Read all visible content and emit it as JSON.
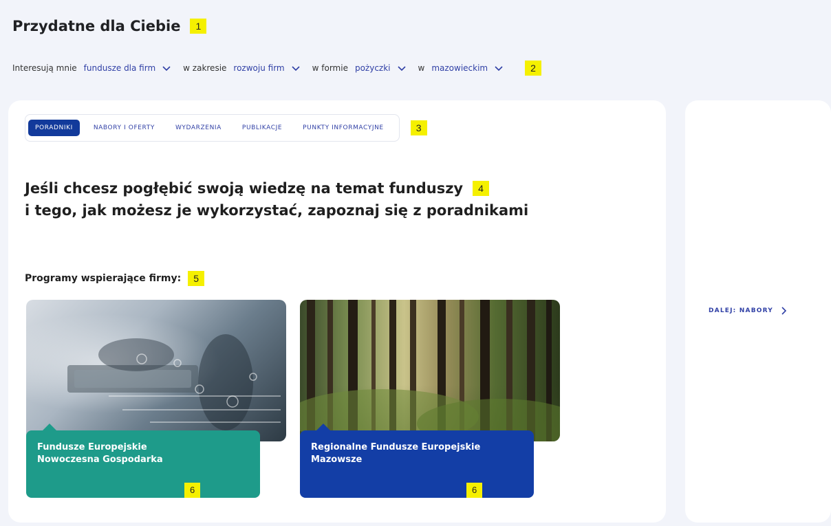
{
  "header": {
    "title": "Przydatne dla Ciebie",
    "marker": "1"
  },
  "filters": {
    "prefix": "Interesują mnie",
    "in_scope": "w zakresie",
    "in_form": "w formie",
    "in_region": "w",
    "funds": "fundusze dla firm",
    "scope": "rozwoju firm",
    "form": "pożyczki",
    "region": "mazowieckim",
    "marker": "2"
  },
  "tabs": {
    "items": [
      "PORADNIKI",
      "NABORY I OFERTY",
      "WYDARZENIA",
      "PUBLIKACJE",
      "PUNKTY INFORMACYJNE"
    ],
    "active": "PORADNIKI",
    "marker": "3"
  },
  "lead": {
    "line1": "Jeśli chcesz pogłębić swoją wiedzę na temat funduszy",
    "line2": "i tego, jak możesz je wykorzystać, zapoznaj się z poradnikami",
    "marker": "4"
  },
  "programs": {
    "label": "Programy wspierające firmy:",
    "marker": "5",
    "cards": [
      {
        "title_line1": "Fundusze Europejskie",
        "title_line2": "Nowoczesna Gospodarka",
        "marker": "6"
      },
      {
        "title_line1": "Regionalne Fundusze Europejskie",
        "title_line2": "Mazowsze",
        "marker": "6"
      }
    ]
  },
  "side": {
    "next_label": "DALEJ: NABORY"
  },
  "colors": {
    "background": "#f2f4fa",
    "brand_blue": "#2f3fa5",
    "active_tab": "#123a9b",
    "teal_card": "#1e9b8a",
    "blue_card": "#133ea6",
    "marker_yellow": "#f5f000"
  }
}
